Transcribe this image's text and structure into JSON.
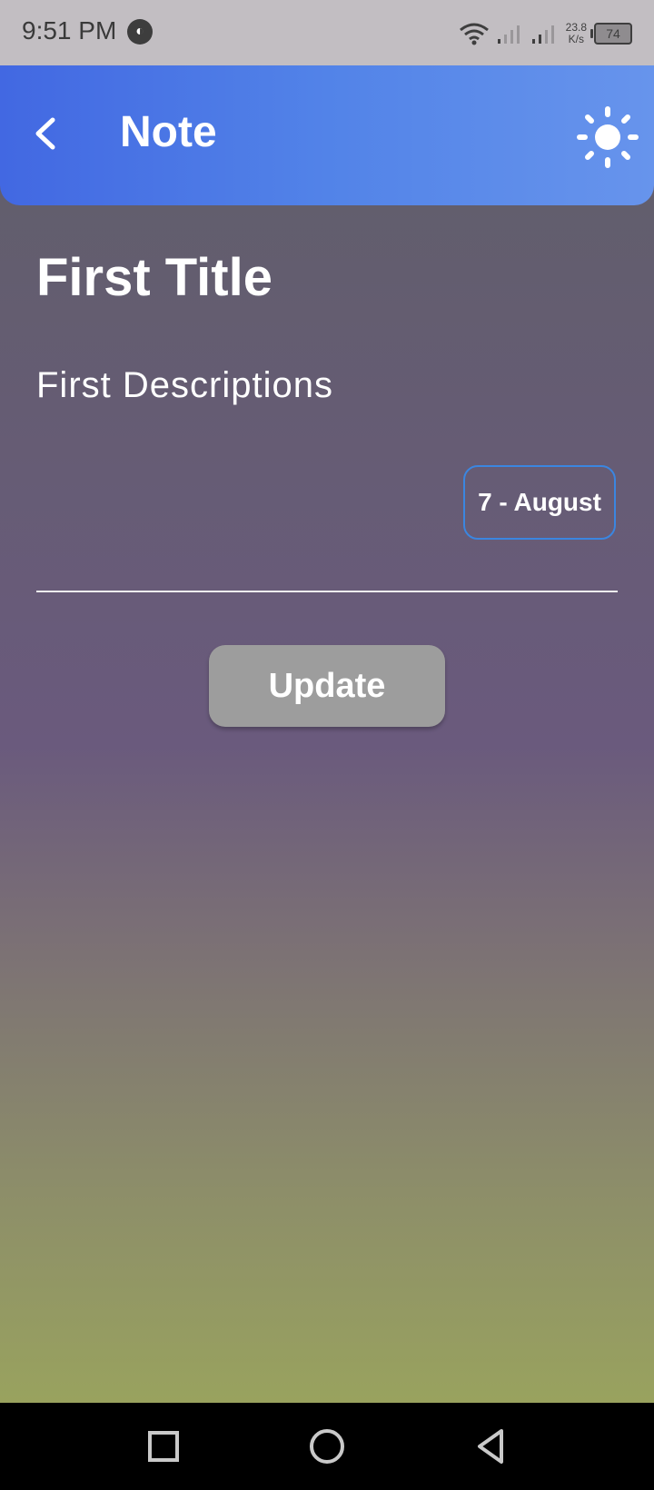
{
  "status_bar": {
    "time": "9:51 PM",
    "net_speed_value": "23.8",
    "net_speed_unit": "K/s",
    "battery_level": "74"
  },
  "app_bar": {
    "title": "Note",
    "back_icon": "chevron-left-icon",
    "theme_icon": "sun-icon"
  },
  "note": {
    "title": "First Title",
    "description": "First Descriptions",
    "date": "7 - August"
  },
  "actions": {
    "update_label": "Update"
  },
  "nav_bar": {
    "recents_icon": "square-icon",
    "home_icon": "circle-icon",
    "back_icon": "triangle-back-icon"
  },
  "colors": {
    "app_bar_start": "#4268e2",
    "app_bar_end": "#6794ec",
    "date_border": "#3b86e0",
    "update_button": "#9d9d9d"
  }
}
